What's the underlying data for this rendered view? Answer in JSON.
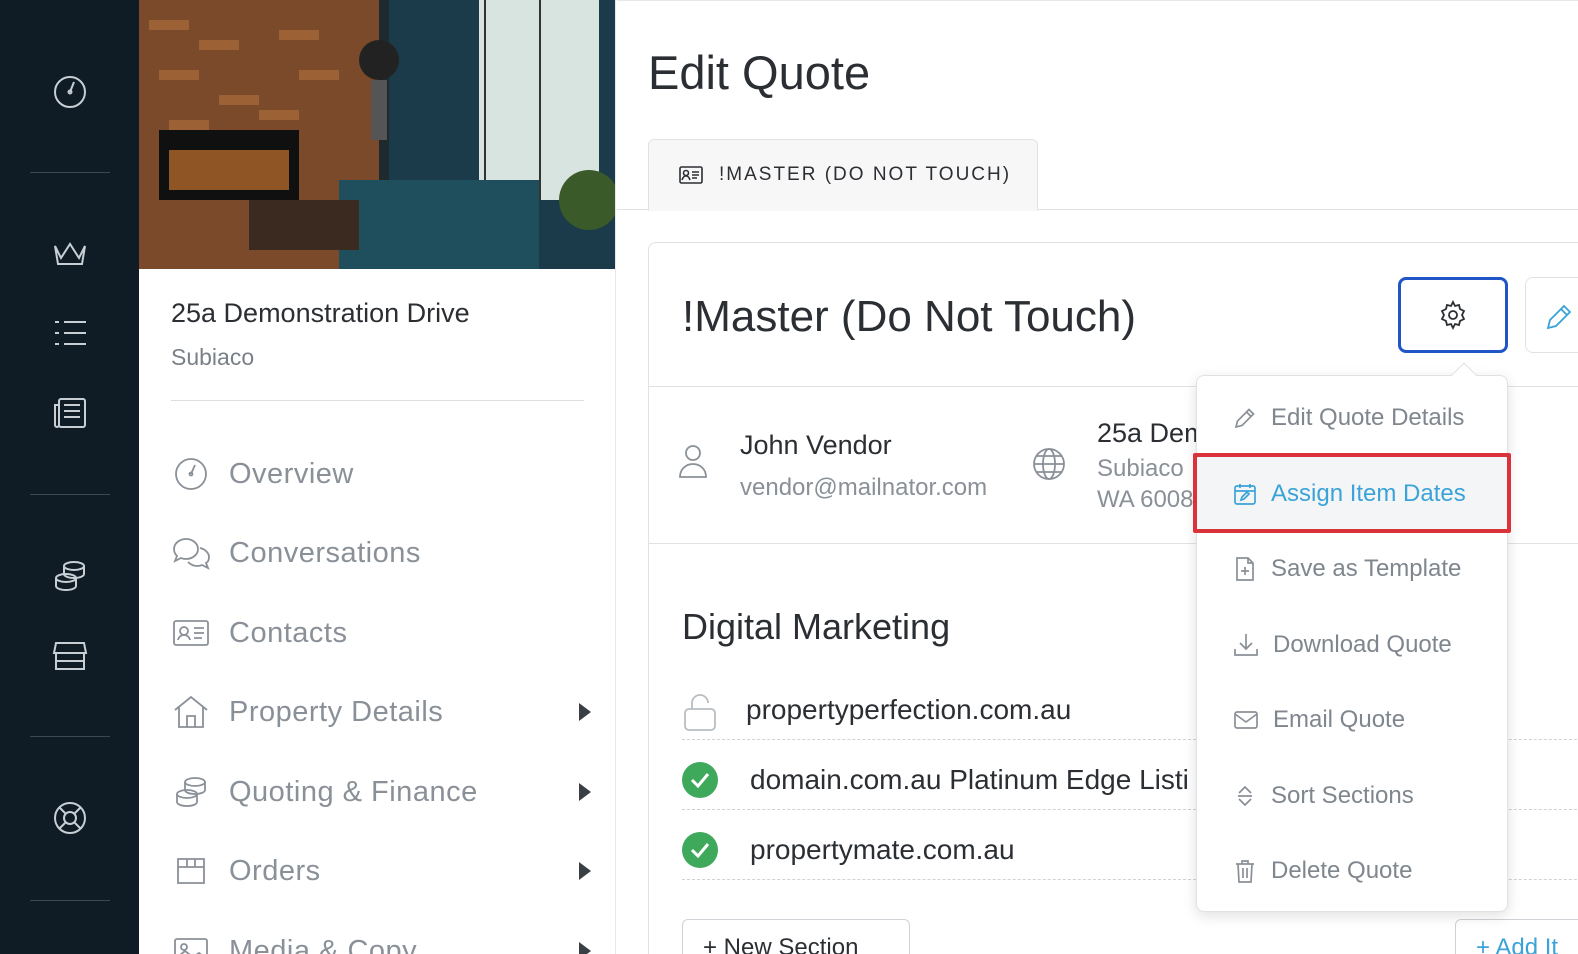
{
  "rail": {
    "icons": [
      "dashboard-icon",
      "crown-icon",
      "list-icon",
      "newspaper-icon",
      "coins-icon",
      "store-icon",
      "lifebuoy-icon"
    ]
  },
  "property": {
    "name": "25a Demonstration Drive",
    "suburb": "Subiaco"
  },
  "nav": {
    "items": [
      {
        "label": "Overview",
        "icon": "dashboard-icon",
        "has_arrow": false
      },
      {
        "label": "Conversations",
        "icon": "chat-icon",
        "has_arrow": false
      },
      {
        "label": "Contacts",
        "icon": "contact-card-icon",
        "has_arrow": false
      },
      {
        "label": "Property Details",
        "icon": "home-icon",
        "has_arrow": true
      },
      {
        "label": "Quoting & Finance",
        "icon": "coins-icon",
        "has_arrow": true
      },
      {
        "label": "Orders",
        "icon": "box-icon",
        "has_arrow": true
      },
      {
        "label": "Media & Copy",
        "icon": "image-icon",
        "has_arrow": true
      }
    ]
  },
  "main": {
    "page_title": "Edit Quote",
    "tab_label": "!MASTER (DO NOT TOUCH)",
    "card_title": "!Master (Do Not Touch)",
    "contact": {
      "name": "John Vendor",
      "email": "vendor@mailnator.com"
    },
    "address": {
      "line1": "25a Dem",
      "line2": "Subiaco",
      "line3": "WA 6008"
    },
    "section_title": "Digital Marketing",
    "items": [
      {
        "label": "propertyperfection.com.au",
        "status": "locked"
      },
      {
        "label": "domain.com.au Platinum Edge Listi",
        "status": "checked"
      },
      {
        "label": "propertymate.com.au",
        "status": "checked"
      }
    ],
    "new_section_label": "+ New Section",
    "add_label": "+ Add It"
  },
  "dropdown": {
    "items": [
      {
        "label": "Edit Quote Details",
        "icon": "pencil-icon"
      },
      {
        "label": "Assign Item Dates",
        "icon": "calendar-edit-icon",
        "active": true
      },
      {
        "label": "Save as Template",
        "icon": "file-plus-icon"
      },
      {
        "label": "Download Quote",
        "icon": "download-icon"
      },
      {
        "label": "Email Quote",
        "icon": "envelope-icon"
      },
      {
        "label": "Sort Sections",
        "icon": "sort-icon"
      },
      {
        "label": "Delete Quote",
        "icon": "trash-icon"
      }
    ]
  },
  "colors": {
    "rail_bg": "#0f1c26",
    "accent_blue": "#3aa3d8",
    "focus_border": "#1f55c7",
    "check_green": "#3ea85b",
    "highlight_red": "#d9323b"
  }
}
